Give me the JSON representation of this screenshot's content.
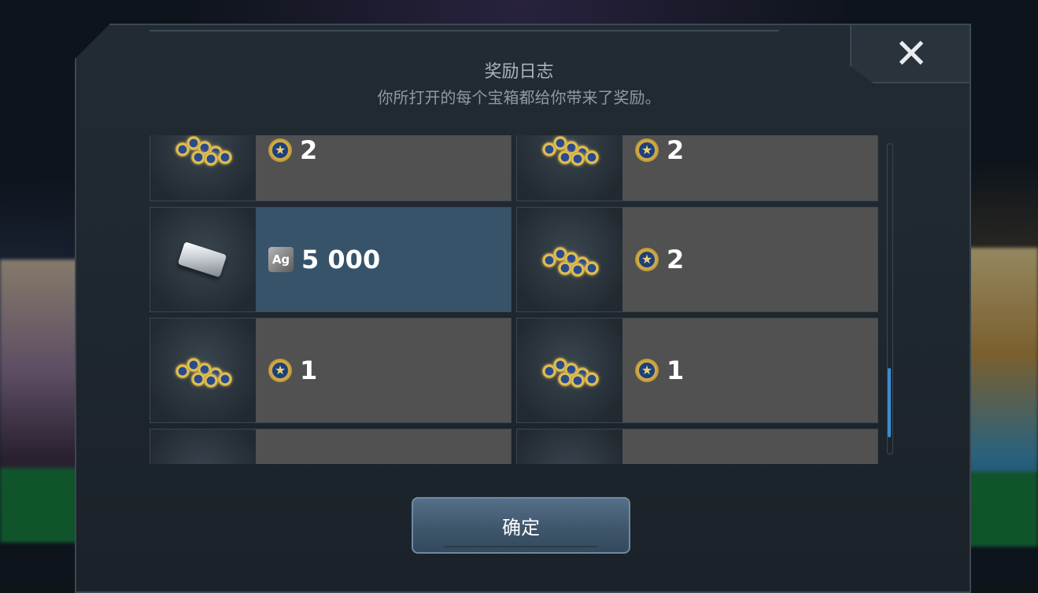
{
  "dialog": {
    "title": "奖励日志",
    "subtitle": "你所打开的每个宝箱都给你带来了奖励。",
    "close_icon": "close-icon",
    "confirm_label": "确定"
  },
  "rewards": [
    {
      "thumb": "coin-pile-icon",
      "currency_icon": "star-coin-icon",
      "amount": "2",
      "highlighted": false
    },
    {
      "thumb": "coin-pile-icon",
      "currency_icon": "star-coin-icon",
      "amount": "2",
      "highlighted": false
    },
    {
      "thumb": "silver-bar-icon",
      "currency_icon": "silver-ag-icon",
      "currency_label": "Ag",
      "amount": "5 000",
      "highlighted": true
    },
    {
      "thumb": "coin-pile-icon",
      "currency_icon": "star-coin-icon",
      "amount": "2",
      "highlighted": false
    },
    {
      "thumb": "coin-pile-icon",
      "currency_icon": "star-coin-icon",
      "amount": "1",
      "highlighted": false
    },
    {
      "thumb": "coin-pile-icon",
      "currency_icon": "star-coin-icon",
      "amount": "1",
      "highlighted": false
    }
  ],
  "colors": {
    "highlight": "#37536a",
    "row": "#515151",
    "scroll_thumb": "#3a8ed2"
  }
}
